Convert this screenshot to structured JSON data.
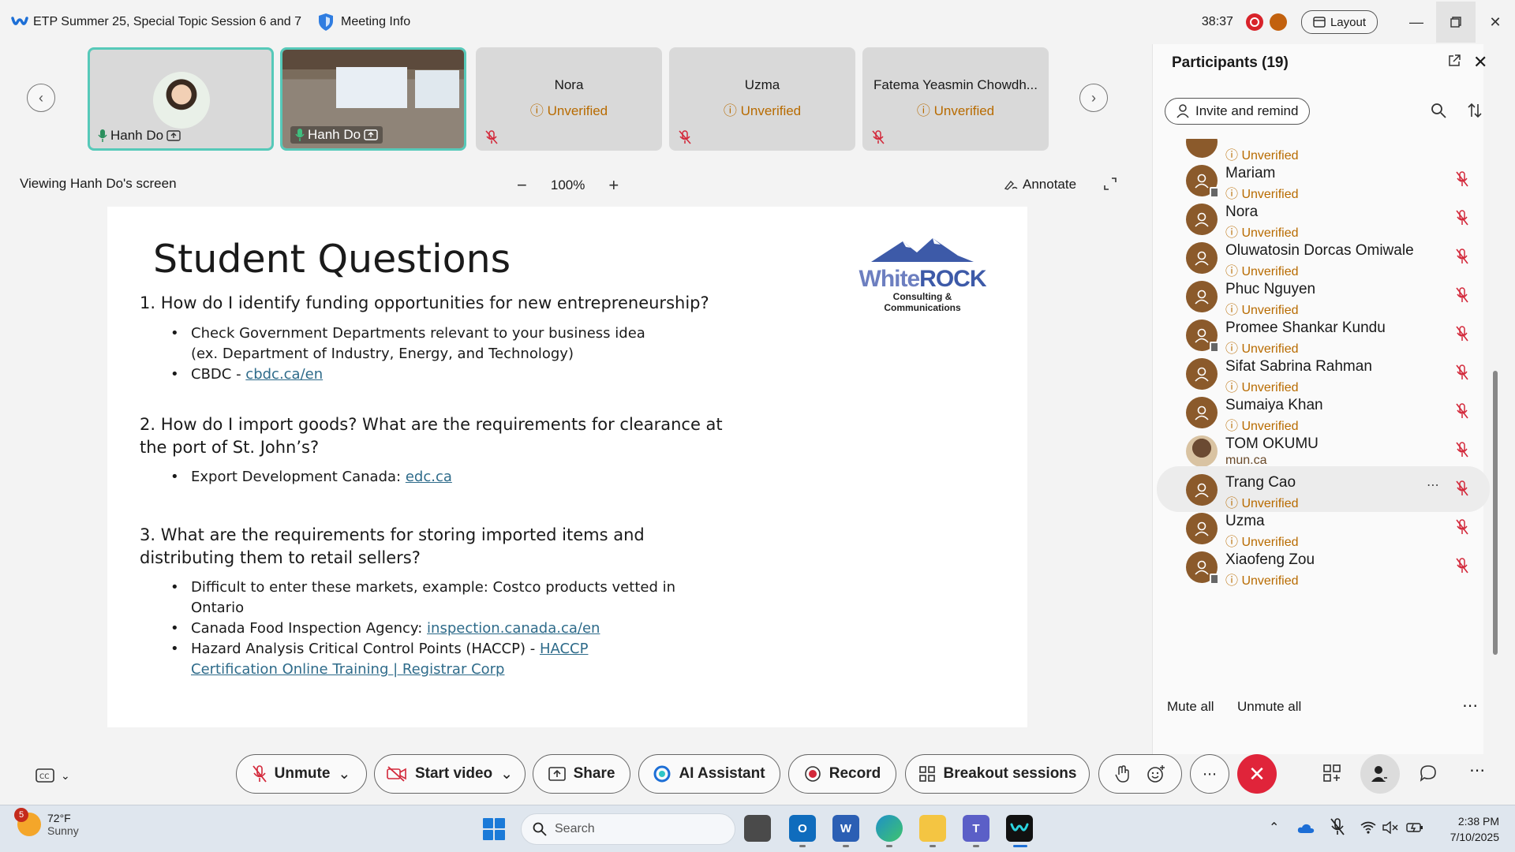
{
  "titlebar": {
    "meeting_title": "ETP Summer 25, Special Topic Session 6 and 7",
    "meeting_info": "Meeting Info",
    "timer": "38:37",
    "layout_label": "Layout"
  },
  "video_strip": {
    "tiles": [
      {
        "name": "Hanh Do",
        "type": "photo"
      },
      {
        "name": "Hanh Do",
        "type": "room"
      },
      {
        "name": "Nora",
        "status": "Unverified"
      },
      {
        "name": "Uzma",
        "status": "Unverified"
      },
      {
        "name": "Fatema Yeasmin Chowdh...",
        "status": "Unverified"
      }
    ]
  },
  "share": {
    "viewing_label": "Viewing Hanh Do's screen",
    "zoom_level": "100%",
    "zoom_minus": "−",
    "zoom_plus": "+",
    "annotate_label": "Annotate"
  },
  "slide": {
    "title": "Student Questions",
    "logo_word_a": "White",
    "logo_word_b": "ROCK",
    "logo_sub": "Consulting & Communications",
    "q1": "1. How do I identify funding opportunities for new entrepreneurship?",
    "q1_b1": "Check Government Departments relevant to your business idea (ex. Department of Industry, Energy, and Technology)",
    "q1_b2_prefix": "CBDC - ",
    "q1_b2_link": "cbdc.ca/en",
    "q2": "2. How do I import goods? What are the requirements for clearance at the port of St. John’s?",
    "q2_b1_prefix": "Export Development Canada: ",
    "q2_b1_link": "edc.ca",
    "q3": "3. What are the requirements for storing imported items and distributing them to retail sellers?",
    "q3_b1": "Difficult to enter these markets, example: Costco products vetted in Ontario",
    "q3_b2_prefix": "Canada Food Inspection Agency: ",
    "q3_b2_link": "inspection.canada.ca/en",
    "q3_b3_prefix": "Hazard Analysis Critical Control Points (HACCP) - ",
    "q3_b3_link": "HACCP Certification Online Training | Registrar Corp"
  },
  "participants": {
    "title": "Participants (19)",
    "invite_label": "Invite and remind",
    "top_partial_status": "Unverified",
    "list": [
      {
        "name": "Mariam",
        "status": "Unverified",
        "badge": true
      },
      {
        "name": "Nora",
        "status": "Unverified"
      },
      {
        "name": "Oluwatosin Dorcas Omiwale",
        "status": "Unverified"
      },
      {
        "name": "Phuc Nguyen",
        "status": "Unverified"
      },
      {
        "name": "Promee Shankar Kundu",
        "status": "Unverified",
        "badge": true
      },
      {
        "name": "Sifat Sabrina Rahman",
        "status": "Unverified"
      },
      {
        "name": "Sumaiya Khan",
        "status": "Unverified"
      },
      {
        "name": "TOM OKUMU",
        "status": "mun.ca",
        "photo": true
      },
      {
        "name": "Trang Cao",
        "status": "Unverified",
        "highlighted": true
      },
      {
        "name": "Uzma",
        "status": "Unverified"
      },
      {
        "name": "Xiaofeng Zou",
        "status": "Unverified",
        "badge": true
      }
    ],
    "mute_all": "Mute all",
    "unmute_all": "Unmute all"
  },
  "controls": {
    "unmute": "Unmute",
    "start_video": "Start video",
    "share": "Share",
    "ai_assistant": "AI Assistant",
    "record": "Record",
    "breakout": "Breakout sessions"
  },
  "taskbar": {
    "weather_badge": "5",
    "temperature": "72°F",
    "condition": "Sunny",
    "search_placeholder": "Search",
    "time": "2:38 PM",
    "date": "7/10/2025"
  },
  "colors": {
    "accent_teal": "#56c9b9",
    "unverified": "#b86b00",
    "end_call": "#e0243a",
    "avatar_brown": "#8b5a2b"
  }
}
